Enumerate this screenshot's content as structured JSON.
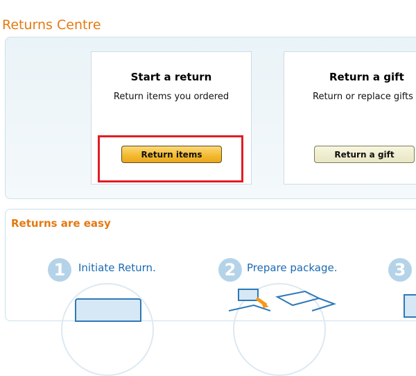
{
  "page": {
    "title": "Returns Centre"
  },
  "start_return": {
    "heading": "Start a return",
    "subtext": "Return items you ordered",
    "button_label": "Return items"
  },
  "return_gift": {
    "heading": "Return a gift",
    "subtext": "Return or replace gifts",
    "button_label": "Return a gift"
  },
  "easy": {
    "title": "Returns are easy",
    "steps": [
      {
        "number": "1",
        "label": "Initiate Return."
      },
      {
        "number": "2",
        "label": "Prepare package."
      },
      {
        "number": "3",
        "label": ""
      }
    ]
  },
  "colors": {
    "accent": "#e47911",
    "link": "#1a6ab3",
    "highlight": "#e21b24",
    "button_primary": "#f3b92e"
  }
}
